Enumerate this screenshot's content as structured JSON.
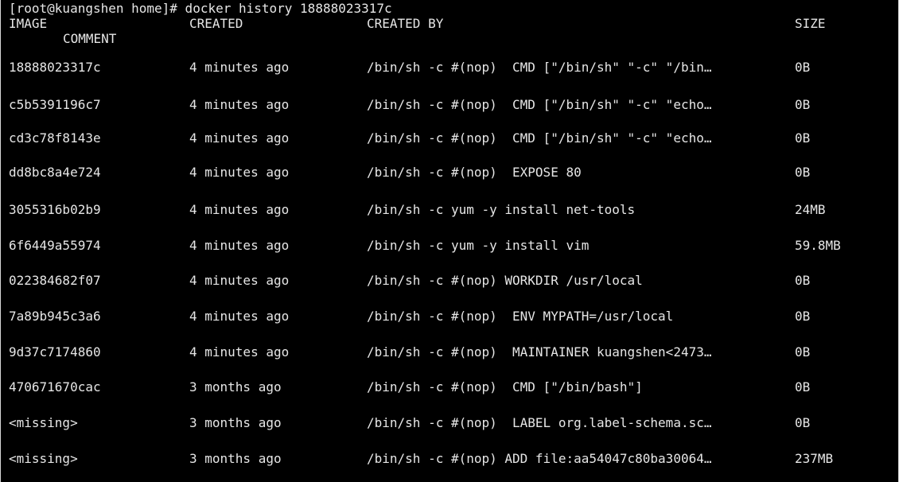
{
  "terminal": {
    "prompt": "[root@kuangshen home]# docker history 18888023317c"
  },
  "table": {
    "headers": {
      "image": "IMAGE",
      "created": "CREATED",
      "created_by": "CREATED BY",
      "size": "SIZE",
      "comment": "COMMENT"
    },
    "rows": [
      {
        "image": "18888023317c",
        "created": "4 minutes ago",
        "created_by": "/bin/sh -c #(nop)  CMD [\"/bin/sh\" \"-c\" \"/bin…",
        "size": "0B"
      },
      {
        "image": "c5b5391196c7",
        "created": "4 minutes ago",
        "created_by": "/bin/sh -c #(nop)  CMD [\"/bin/sh\" \"-c\" \"echo…",
        "size": "0B"
      },
      {
        "image": "cd3c78f8143e",
        "created": "4 minutes ago",
        "created_by": "/bin/sh -c #(nop)  CMD [\"/bin/sh\" \"-c\" \"echo…",
        "size": "0B"
      },
      {
        "image": "dd8bc8a4e724",
        "created": "4 minutes ago",
        "created_by": "/bin/sh -c #(nop)  EXPOSE 80",
        "size": "0B"
      },
      {
        "image": "3055316b02b9",
        "created": "4 minutes ago",
        "created_by": "/bin/sh -c yum -y install net-tools",
        "size": "24MB"
      },
      {
        "image": "6f6449a55974",
        "created": "4 minutes ago",
        "created_by": "/bin/sh -c yum -y install vim",
        "size": "59.8MB"
      },
      {
        "image": "022384682f07",
        "created": "4 minutes ago",
        "created_by": "/bin/sh -c #(nop) WORKDIR /usr/local",
        "size": "0B"
      },
      {
        "image": "7a89b945c3a6",
        "created": "4 minutes ago",
        "created_by": "/bin/sh -c #(nop)  ENV MYPATH=/usr/local",
        "size": "0B"
      },
      {
        "image": "9d37c7174860",
        "created": "4 minutes ago",
        "created_by": "/bin/sh -c #(nop)  MAINTAINER kuangshen<2473…",
        "size": "0B"
      },
      {
        "image": "470671670cac",
        "created": "3 months ago",
        "created_by": "/bin/sh -c #(nop)  CMD [\"/bin/bash\"]",
        "size": "0B"
      },
      {
        "image": "<missing>",
        "created": "3 months ago",
        "created_by": "/bin/sh -c #(nop)  LABEL org.label-schema.sc…",
        "size": "0B"
      },
      {
        "image": "<missing>",
        "created": "3 months ago",
        "created_by": "/bin/sh -c #(nop) ADD file:aa54047c80ba30064…",
        "size": "237MB"
      }
    ]
  }
}
